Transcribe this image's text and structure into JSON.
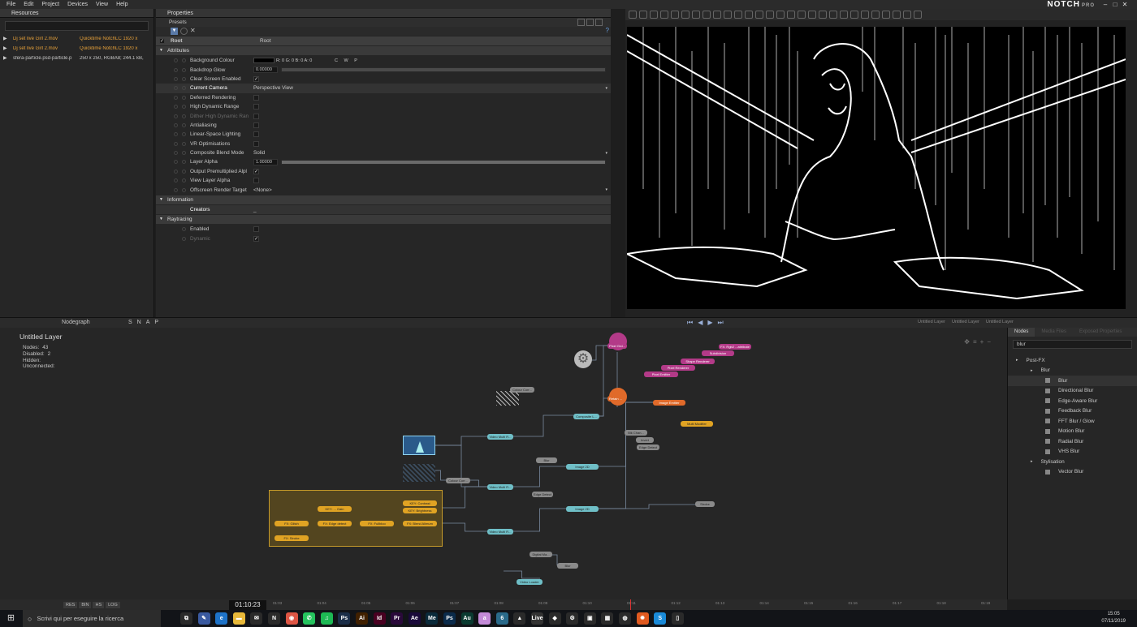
{
  "menu": [
    "File",
    "Edit",
    "Project",
    "Devices",
    "View",
    "Help"
  ],
  "brand": {
    "name": "NOTCH",
    "edition": "PRO"
  },
  "resources": {
    "title": "Resources",
    "items": [
      {
        "name": "Dj set live Girl 2.mov",
        "info": "Quicktime NotchLC 1920 x",
        "highlight": true
      },
      {
        "name": "Dj set live Girl 2.mov",
        "info": "Quicktime NotchLC 1920 x",
        "highlight": true
      },
      {
        "name": "sfera-particle.psd-particle.p",
        "info": "250 x 250, RGBA8; 244.1 kB,",
        "highlight": false
      }
    ]
  },
  "properties": {
    "title": "Properties",
    "presets": "Presets",
    "root": {
      "label": "Root",
      "value": "Root"
    },
    "sections": {
      "attributes": "Attributes",
      "information": "Information",
      "raytracing": "Raytracing"
    },
    "rows": [
      {
        "label": "Background Colour",
        "value": "R: 0 G: 0 B: 0 A: 0",
        "kind": "color",
        "extra": "C W P"
      },
      {
        "label": "Backdrop Glow",
        "value": "0.00000",
        "kind": "number"
      },
      {
        "label": "Clear Screen Enabled",
        "kind": "check",
        "checked": true
      },
      {
        "label": "Current Camera",
        "value": "Perspective View",
        "kind": "select",
        "bold": true
      },
      {
        "label": "Deferred Rendering",
        "kind": "check",
        "checked": false
      },
      {
        "label": "High Dynamic Range",
        "kind": "check",
        "checked": false
      },
      {
        "label": "Dither High Dynamic Ran",
        "kind": "check",
        "checked": false,
        "disabled": true
      },
      {
        "label": "Antialiasing",
        "kind": "check",
        "checked": false
      },
      {
        "label": "Linear-Space Lighting",
        "kind": "check",
        "checked": false
      },
      {
        "label": "VR Optimisations",
        "kind": "check",
        "checked": false
      },
      {
        "label": "Composite Blend Mode",
        "value": "Solid",
        "kind": "select"
      },
      {
        "label": "Layer Alpha",
        "value": "1.00000",
        "kind": "number",
        "barfill": 1.0
      },
      {
        "label": "Output Premultiplied Alpl",
        "kind": "check",
        "checked": true
      },
      {
        "label": "View Layer Alpha",
        "kind": "check",
        "checked": false
      },
      {
        "label": "Offscreen Render Target",
        "value": "<None>",
        "kind": "select"
      }
    ],
    "info_rows": [
      {
        "label": "Creators",
        "value": "_"
      }
    ],
    "ray_rows": [
      {
        "label": "Enabled",
        "checked": false,
        "disabled": false
      },
      {
        "label": "Dynamic",
        "checked": true,
        "disabled": true
      }
    ]
  },
  "nodegraph": {
    "tab": "Nodegraph",
    "toolbar_letters": [
      "S",
      "N",
      "A",
      "P"
    ],
    "layer_title": "Untitled  Layer",
    "stats": [
      {
        "label": "Nodes:",
        "value": "43"
      },
      {
        "label": "Disabled:",
        "value": "2"
      },
      {
        "label": "Hidden:",
        "value": ""
      },
      {
        "label": "Unconnected:",
        "value": ""
      }
    ],
    "side_tabs": [
      "Nodegraph",
      "Timeline",
      "Curve Editor",
      "Stacks"
    ],
    "layer_tabs": [
      "Untitled Layer",
      "Untitled Layer",
      "Untitled Layer"
    ],
    "nodes": [
      {
        "label": "Pixel Grd...",
        "color": "p"
      },
      {
        "label": "Retain ...",
        "color": "o"
      },
      {
        "label": "Image Emitter",
        "color": "o"
      },
      {
        "label": "Multi Modifier",
        "color": "y"
      },
      {
        "label": "Composite L...",
        "color": "c"
      },
      {
        "label": "Video Multi R...",
        "color": "c"
      },
      {
        "label": "Video Multi R...",
        "color": "c"
      },
      {
        "label": "Video Multi R...",
        "color": "c"
      },
      {
        "label": "Image 2D",
        "color": "c"
      },
      {
        "label": "Image 2D",
        "color": "c"
      },
      {
        "label": "Video Loader",
        "color": "c"
      },
      {
        "label": "Colour Corr...",
        "color": "g"
      },
      {
        "label": "Colour Corr...",
        "color": "g"
      },
      {
        "label": "Blk Chan...",
        "color": "g"
      },
      {
        "label": "Edge Detect",
        "color": "g"
      },
      {
        "label": "Edge Detect",
        "color": "g"
      },
      {
        "label": "Strobe",
        "color": "g"
      },
      {
        "label": "Blur",
        "color": "g"
      },
      {
        "label": "Blur",
        "color": "g"
      },
      {
        "label": "Invert",
        "color": "g"
      },
      {
        "label": "Digital Ma...",
        "color": "g"
      },
      {
        "label": "Pixel Emitter",
        "color": "p"
      },
      {
        "label": "Pixel Renderer",
        "color": "p"
      },
      {
        "label": "Shape Renderer",
        "color": "p"
      },
      {
        "label": "Subdivision",
        "color": "p"
      },
      {
        "label": "FX: Rgb2 ...attribute",
        "color": "p"
      },
      {
        "label": "KEY: Contrast",
        "color": "y"
      },
      {
        "label": "KEY: Brightness",
        "color": "y"
      },
      {
        "label": "KEY: ... Gain",
        "color": "y"
      },
      {
        "label": "FX: Glitch",
        "color": "y"
      },
      {
        "label": "FX: Edge detect",
        "color": "y"
      },
      {
        "label": "FX: Fullbloo",
        "color": "y"
      },
      {
        "label": "FX: Blend Alimum",
        "color": "y"
      },
      {
        "label": "FX: Strobe",
        "color": "y"
      }
    ]
  },
  "library": {
    "tabs": [
      "Nodes",
      "Media Files",
      "Exposed Properties"
    ],
    "search": "blur",
    "tree": [
      {
        "label": "Post-FX",
        "level": 0,
        "arrow": true
      },
      {
        "label": "Blur",
        "level": 1,
        "arrow": true
      },
      {
        "label": "Blur",
        "level": 2,
        "selected": true
      },
      {
        "label": "Directional Blur",
        "level": 2
      },
      {
        "label": "Edge-Aware Blur",
        "level": 2
      },
      {
        "label": "Feedback Blur",
        "level": 2
      },
      {
        "label": "FFT Blur / Glow",
        "level": 2
      },
      {
        "label": "Motion Blur",
        "level": 2
      },
      {
        "label": "Radial Blur",
        "level": 2
      },
      {
        "label": "VHS Blur",
        "level": 2
      },
      {
        "label": "Stylisation",
        "level": 1,
        "arrow": true
      },
      {
        "label": "Vector Blur",
        "level": 2
      }
    ]
  },
  "timeline": {
    "timecode": "01:10:23",
    "buttons": [
      "RES",
      "BIN",
      "HS",
      "LOG"
    ],
    "ticks": [
      "01:03",
      "01:04",
      "01:05",
      "01:06",
      "01:07",
      "01:08",
      "01:09",
      "01:10",
      "01:11",
      "01:12",
      "01:13",
      "01:14",
      "01:15",
      "01:16",
      "01:17",
      "01:18",
      "01:19"
    ]
  },
  "taskbar": {
    "search_placeholder": "Scrivi qui per eseguire la ricerca",
    "time": "15:05",
    "date": "07/11/2019",
    "apps": [
      {
        "icon": "task-view-icon",
        "label": "⧉",
        "color": "#2a2a2a"
      },
      {
        "icon": "paint-icon",
        "label": "✎",
        "color": "#3a5aa0"
      },
      {
        "icon": "edge-icon",
        "label": "e",
        "color": "#1e73c8"
      },
      {
        "icon": "folder-icon",
        "label": "▬",
        "color": "#e8b93a"
      },
      {
        "icon": "mail-icon",
        "label": "✉",
        "color": "#2a2a2a"
      },
      {
        "icon": "notch-icon",
        "label": "N",
        "color": "#2a2a2a"
      },
      {
        "icon": "chrome-icon",
        "label": "◉",
        "color": "#d54"
      },
      {
        "icon": "whatsapp-icon",
        "label": "✆",
        "color": "#25c35e"
      },
      {
        "icon": "spotify-icon",
        "label": "♫",
        "color": "#1db954"
      },
      {
        "icon": "photoshop-icon",
        "label": "Ps",
        "color": "#1b2e48"
      },
      {
        "icon": "illustrator-icon",
        "label": "Ai",
        "color": "#402000"
      },
      {
        "icon": "indesign-icon",
        "label": "Id",
        "color": "#490021"
      },
      {
        "icon": "premiere-icon",
        "label": "Pr",
        "color": "#2a0a3a"
      },
      {
        "icon": "after-effects-icon",
        "label": "Ae",
        "color": "#1a0a3a"
      },
      {
        "icon": "media-encoder-icon",
        "label": "Me",
        "color": "#0a2a3a"
      },
      {
        "icon": "photoshop2-icon",
        "label": "Ps",
        "color": "#0a2a4a"
      },
      {
        "icon": "audition-icon",
        "label": "Au",
        "color": "#0a3a30"
      },
      {
        "icon": "app-a-icon",
        "label": "a",
        "color": "#c48bd8"
      },
      {
        "icon": "app-6-icon",
        "label": "6",
        "color": "#2a6a8a"
      },
      {
        "icon": "vlc-icon",
        "label": "▲",
        "color": "#2a2a2a"
      },
      {
        "icon": "live-icon",
        "label": "Live",
        "color": "#333"
      },
      {
        "icon": "game-icon",
        "label": "◆",
        "color": "#2a2a2a"
      },
      {
        "icon": "settings-icon",
        "label": "⚙",
        "color": "#2a2a2a"
      },
      {
        "icon": "screen-icon",
        "label": "▣",
        "color": "#2a2a2a"
      },
      {
        "icon": "app-tile-icon",
        "label": "▦",
        "color": "#2a2a2a"
      },
      {
        "icon": "app-circle-icon",
        "label": "◍",
        "color": "#2a2a2a"
      },
      {
        "icon": "app-orange-icon",
        "label": "✹",
        "color": "#e05a20"
      },
      {
        "icon": "app-s-icon",
        "label": "S",
        "color": "#1a8ad8"
      },
      {
        "icon": "notepad-icon",
        "label": "▯",
        "color": "#2a2a2a"
      }
    ]
  }
}
